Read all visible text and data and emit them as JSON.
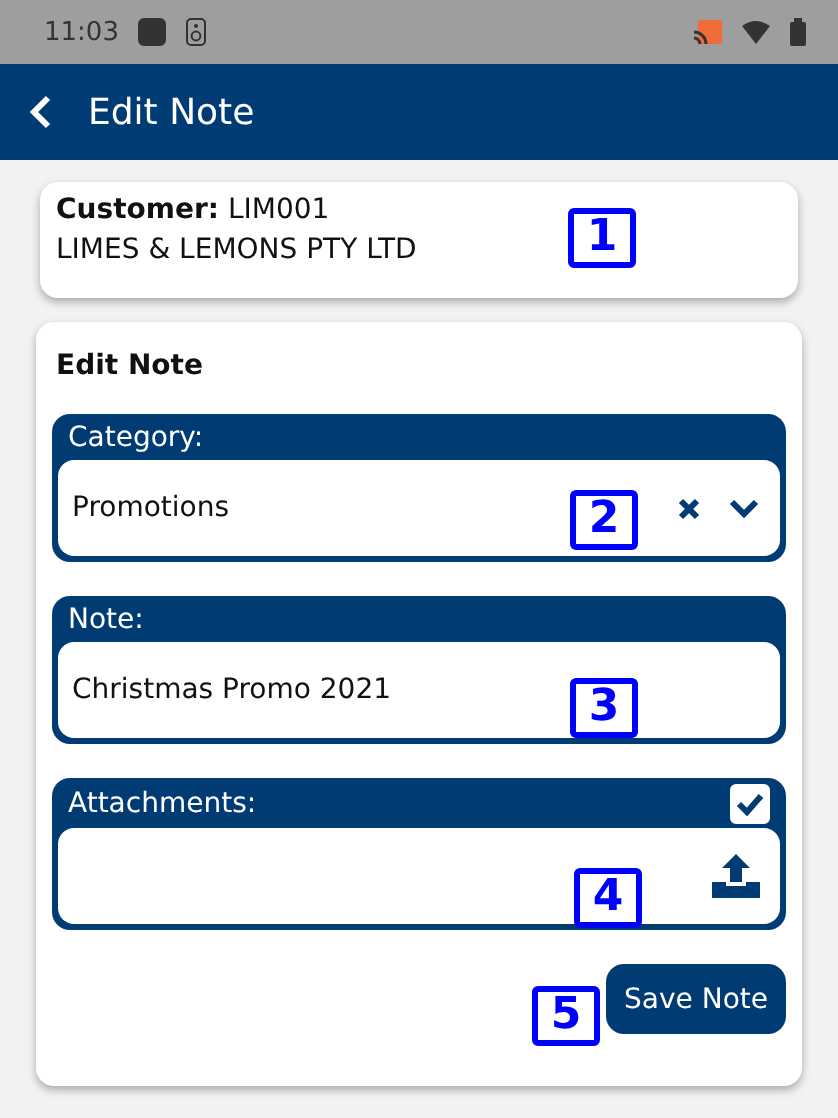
{
  "status_bar": {
    "time": "11:03"
  },
  "app_bar": {
    "title": "Edit Note"
  },
  "customer": {
    "label": "Customer:",
    "code": "LIM001",
    "name": "LIMES & LEMONS PTY LTD"
  },
  "form": {
    "title": "Edit Note",
    "fields": [
      {
        "kind": "select",
        "label": "Category:",
        "value": "Promotions"
      },
      {
        "kind": "text",
        "label": "Note:",
        "value": "Christmas Promo 2021"
      },
      {
        "kind": "upload",
        "label": "Attachments:",
        "checked": true
      }
    ],
    "save_button": "Save Note"
  },
  "markers": [
    "1",
    "2",
    "3",
    "4",
    "5"
  ]
}
